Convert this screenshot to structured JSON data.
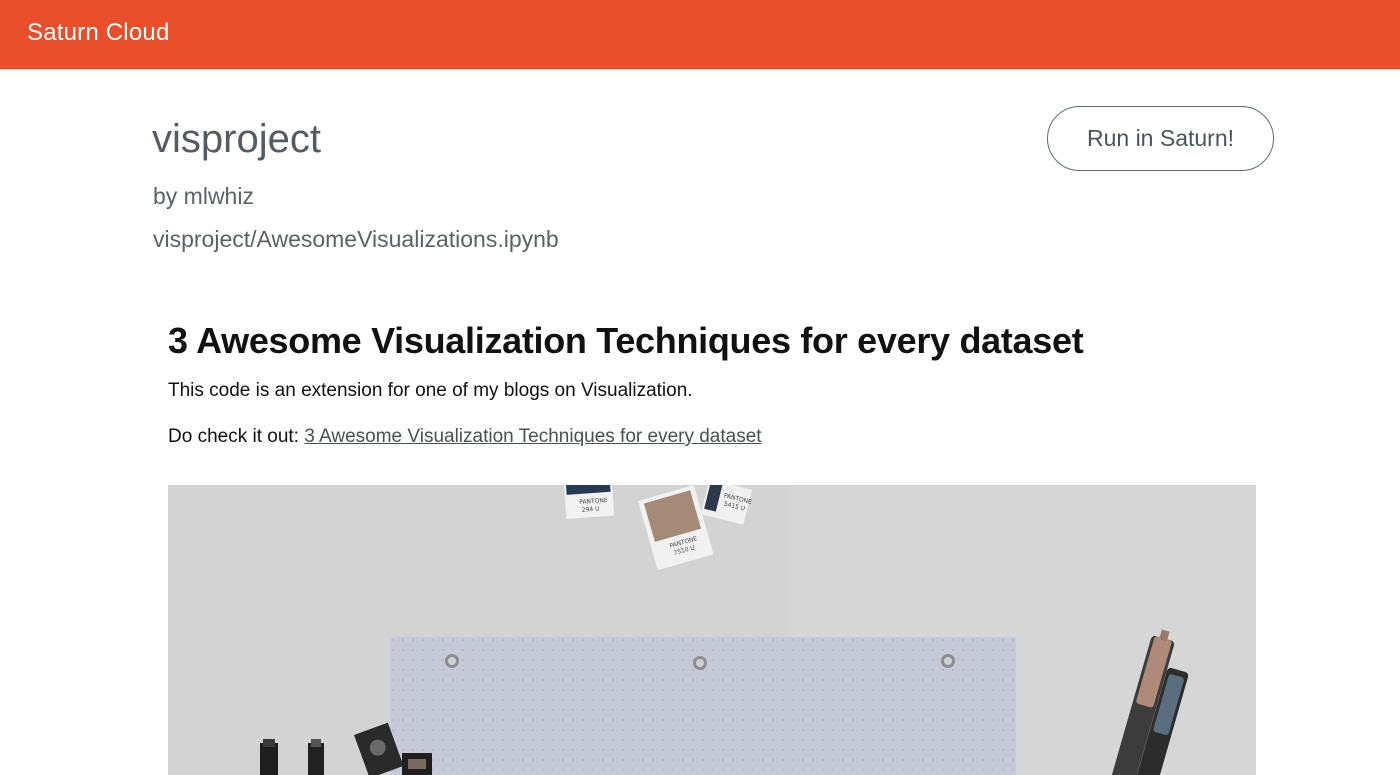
{
  "header": {
    "brand": "Saturn Cloud",
    "brand_color": "#e84e2a"
  },
  "project": {
    "title": "visproject",
    "author": "by mlwhiz",
    "path": "visproject/AwesomeVisualizations.ipynb",
    "run_button": "Run in Saturn!"
  },
  "notebook": {
    "heading": "3 Awesome Visualization Techniques for every dataset",
    "paragraph1": "This code is an extension for one of my blogs on Visualization.",
    "paragraph2_prefix": "Do check it out: ",
    "paragraph2_link": "3 Awesome Visualization Techniques for every dataset",
    "swatch_labels": [
      "PANTONE",
      "294 U",
      "PANTONE",
      "7510 U",
      "PANTONE",
      "5415 U"
    ]
  }
}
